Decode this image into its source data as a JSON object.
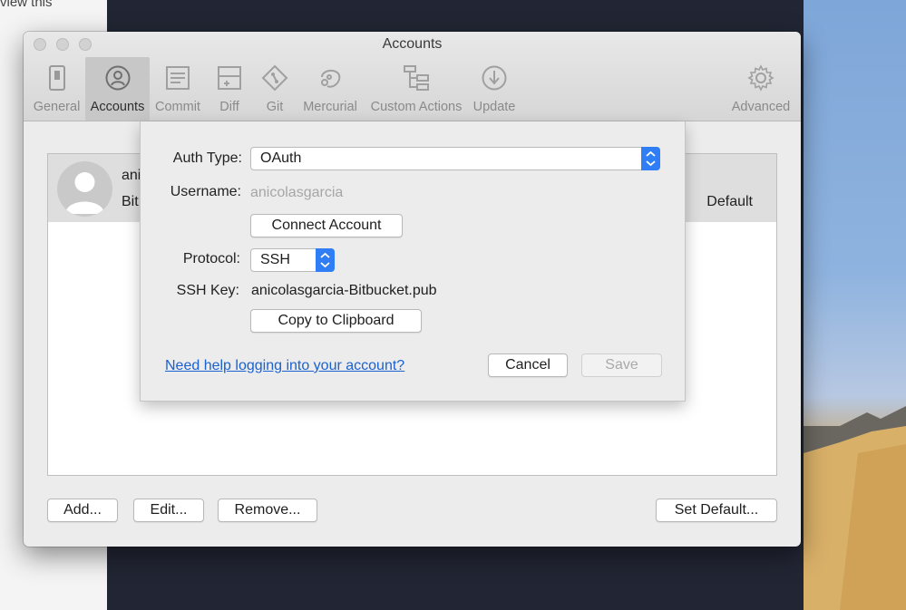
{
  "background": {
    "left_text": "view this"
  },
  "window": {
    "title": "Accounts"
  },
  "toolbar": {
    "items": [
      {
        "label": "General",
        "icon": "general-icon"
      },
      {
        "label": "Accounts",
        "icon": "accounts-icon",
        "selected": true
      },
      {
        "label": "Commit",
        "icon": "commit-icon"
      },
      {
        "label": "Diff",
        "icon": "diff-icon"
      },
      {
        "label": "Git",
        "icon": "git-icon"
      },
      {
        "label": "Mercurial",
        "icon": "mercurial-icon"
      },
      {
        "label": "Custom Actions",
        "icon": "custom-actions-icon"
      },
      {
        "label": "Update",
        "icon": "update-icon"
      },
      {
        "label": "Advanced",
        "icon": "gear-icon"
      }
    ]
  },
  "accounts_list": {
    "row": {
      "name": "ani",
      "subtitle": "Bit",
      "default_label": "Default"
    }
  },
  "bottom_buttons": {
    "add": "Add...",
    "edit": "Edit...",
    "remove": "Remove...",
    "set_default": "Set Default..."
  },
  "sheet": {
    "auth_type_label": "Auth Type:",
    "auth_type_value": "OAuth",
    "username_label": "Username:",
    "username_value": "anicolasgarcia",
    "connect_button": "Connect Account",
    "protocol_label": "Protocol:",
    "protocol_value": "SSH",
    "ssh_key_label": "SSH Key:",
    "ssh_key_value": "anicolasgarcia-Bitbucket.pub",
    "copy_button": "Copy to Clipboard",
    "help_link": "Need help logging into your account?",
    "cancel_button": "Cancel",
    "save_button": "Save"
  },
  "colors": {
    "accent": "#2f7ef6",
    "link": "#1a61d1"
  }
}
